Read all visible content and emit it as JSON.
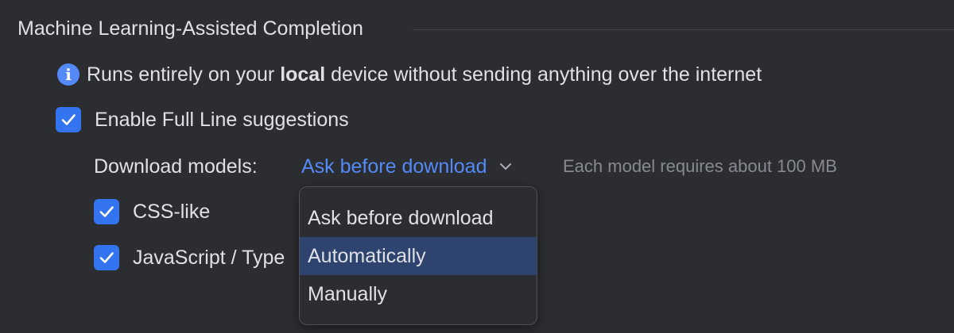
{
  "section": {
    "title": "Machine Learning-Assisted Completion"
  },
  "info": {
    "icon": "info-icon",
    "text_before": "Runs entirely on your ",
    "text_bold": "local",
    "text_after": " device without sending anything over the internet"
  },
  "full_line": {
    "label": "Enable Full Line suggestions",
    "checked": true
  },
  "download": {
    "label": "Download models:",
    "selected": "Ask before download",
    "hint": "Each model requires about 100 MB",
    "options": [
      "Ask before download",
      "Automatically",
      "Manually"
    ],
    "highlighted": "Automatically"
  },
  "languages": [
    {
      "label": "CSS-like",
      "checked": true
    },
    {
      "label": "JavaScript / Type",
      "checked": true
    }
  ],
  "colors": {
    "background": "#2b2d30",
    "accent": "#3574f0",
    "link": "#548af7",
    "highlight": "#2e436e"
  }
}
